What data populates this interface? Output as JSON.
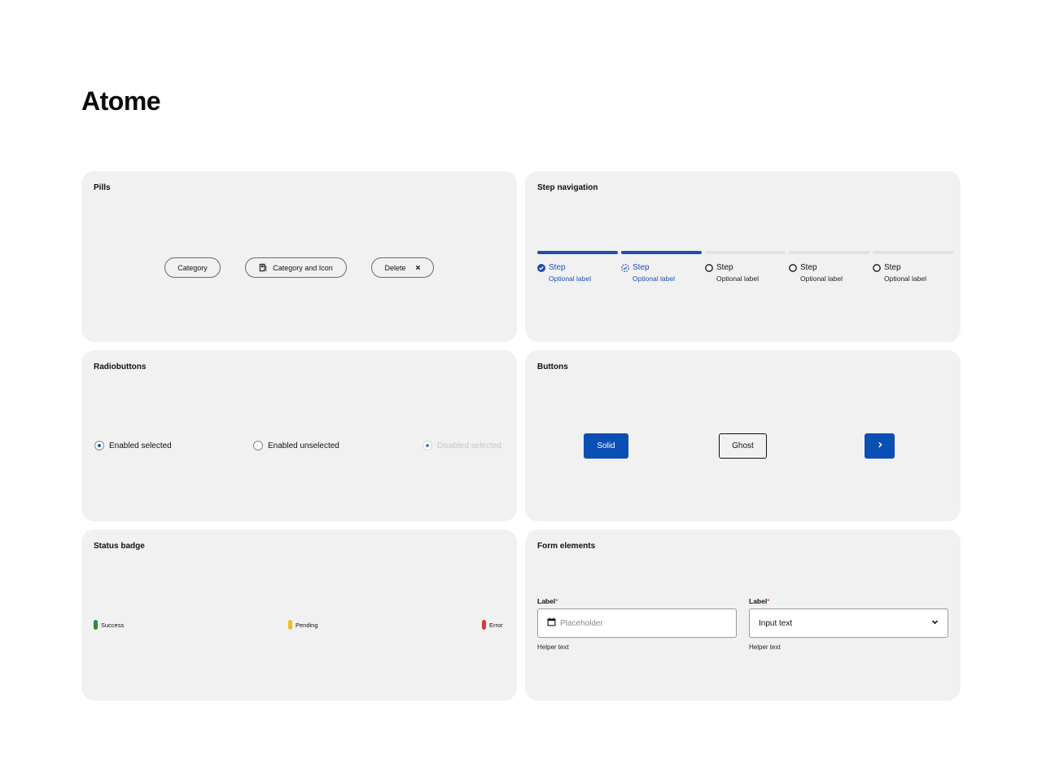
{
  "page": {
    "title": "Atome"
  },
  "pills": {
    "title": "Pills",
    "category": "Category",
    "category_icon": "Category and Icon",
    "category_icon_name": "gas-pump-icon",
    "delete": "Delete",
    "delete_icon_name": "close-icon"
  },
  "steps": {
    "title": "Step navigation",
    "items": [
      {
        "label": "Step",
        "sublabel": "Optional label",
        "state": "complete"
      },
      {
        "label": "Step",
        "sublabel": "Optional label",
        "state": "current"
      },
      {
        "label": "Step",
        "sublabel": "Optional label",
        "state": "incomplete"
      },
      {
        "label": "Step",
        "sublabel": "Optional label",
        "state": "incomplete"
      },
      {
        "label": "Step",
        "sublabel": "Optional label",
        "state": "incomplete"
      }
    ]
  },
  "radios": {
    "title": "Radiobuttons",
    "items": [
      {
        "label": "Enabled selected",
        "selected": true,
        "disabled": false
      },
      {
        "label": "Enabled unselected",
        "selected": false,
        "disabled": false
      },
      {
        "label": "Disabled selected",
        "selected": true,
        "disabled": true
      }
    ]
  },
  "buttons": {
    "title": "Buttons",
    "solid": "Solid",
    "ghost": "Ghost",
    "icon_button_icon": "chevron-right-icon"
  },
  "status": {
    "title": "Status badge",
    "items": [
      {
        "label": "Success",
        "color": "#2e8b3d"
      },
      {
        "label": "Pending",
        "color": "#e6c229"
      },
      {
        "label": "Error",
        "color": "#d83a3a"
      }
    ]
  },
  "form": {
    "title": "Form elements",
    "date_field": {
      "label": "Label",
      "required_mark": "*",
      "placeholder": "Placeholder",
      "helper": "Helper text",
      "icon": "calendar-icon"
    },
    "select_field": {
      "label": "Label",
      "required_mark": "*",
      "value": "Input text",
      "helper": "Helper text",
      "icon": "chevron-down-icon"
    }
  },
  "colors": {
    "accent": "#0a4fb3",
    "card_bg": "#f1f1f1",
    "step_inactive": "#e2e2e2"
  }
}
